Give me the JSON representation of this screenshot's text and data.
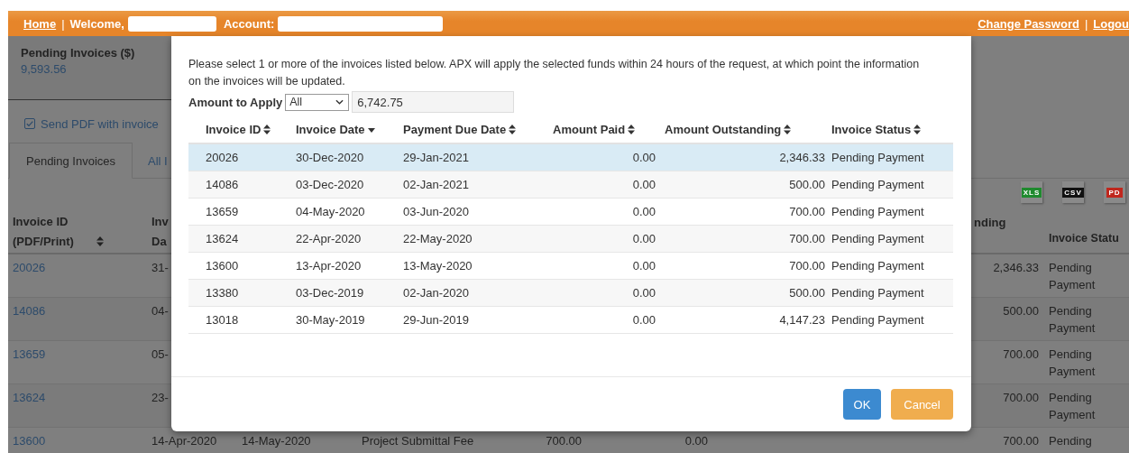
{
  "top_bar": {
    "home": "Home",
    "separator_left": "|",
    "welcome": "Welcome,",
    "account": "Account:",
    "change_password": "Change Password",
    "separator_right": "|",
    "logout": "Logou"
  },
  "summary": {
    "title": "Pending Invoices ($)",
    "value": "9,593.56"
  },
  "send_pdf": {
    "label": "Send PDF with invoice",
    "checked": true
  },
  "tabs": [
    {
      "label": "Pending Invoices",
      "selected": true
    },
    {
      "label": "All I",
      "selected": false
    }
  ],
  "exports": [
    {
      "label": "XLS",
      "color": "#1f8a2e"
    },
    {
      "label": "CSV",
      "color": "#111111"
    },
    {
      "label": "PD",
      "color": "#c0271d"
    }
  ],
  "invoice_table": {
    "columns": [
      {
        "label": "Invoice ID (PDF/Print)",
        "sortable": true
      },
      {
        "label": "Inv Da"
      },
      {
        "label": "nding"
      },
      {
        "label": "Invoice Statu"
      }
    ],
    "rows": [
      {
        "id": "20026",
        "invoice_date": "31-",
        "outstanding": "2,346.33",
        "status": "Pending Payment"
      },
      {
        "id": "14086",
        "invoice_date": "04-",
        "outstanding": "500.00",
        "status": "Pending Payment"
      },
      {
        "id": "13659",
        "invoice_date": "05-",
        "outstanding": "700.00",
        "status": "Pending Payment"
      },
      {
        "id": "13624",
        "invoice_date": "23-",
        "outstanding": "700.00",
        "status": "Pending Payment"
      },
      {
        "id": "13600",
        "invoice_date": "14-Apr-2020",
        "due_date": "14-May-2020",
        "description": "Project Submittal Fee",
        "amount": "700.00",
        "paid": "0.00",
        "outstanding": "700.00",
        "status": "Pending"
      }
    ]
  },
  "dialog": {
    "message": "Please select 1 or more of the invoices listed below. APX will apply the selected funds within 24 hours of the request, at which point the information on the invoices will be updated.",
    "amount_label": "Amount to Apply",
    "amount_mode": "All",
    "amount_value": "6,742.75",
    "columns": [
      {
        "label": "Invoice ID",
        "sorted": false
      },
      {
        "label": "Invoice Date",
        "sorted": true
      },
      {
        "label": "Payment Due Date",
        "sorted": false
      },
      {
        "label": "Amount Paid",
        "sorted": false
      },
      {
        "label": "Amount Outstanding",
        "sorted": false
      },
      {
        "label": "Invoice Status",
        "sorted": false
      }
    ],
    "rows": [
      {
        "selected": true,
        "cells": [
          "20026",
          "30-Dec-2020",
          "29-Jan-2021",
          "0.00",
          "2,346.33",
          "Pending Payment"
        ]
      },
      {
        "selected": false,
        "cells": [
          "14086",
          "03-Dec-2020",
          "02-Jan-2021",
          "0.00",
          "500.00",
          "Pending Payment"
        ]
      },
      {
        "selected": false,
        "cells": [
          "13659",
          "04-May-2020",
          "03-Jun-2020",
          "0.00",
          "700.00",
          "Pending Payment"
        ]
      },
      {
        "selected": false,
        "cells": [
          "13624",
          "22-Apr-2020",
          "22-May-2020",
          "0.00",
          "700.00",
          "Pending Payment"
        ]
      },
      {
        "selected": false,
        "cells": [
          "13600",
          "13-Apr-2020",
          "13-May-2020",
          "0.00",
          "700.00",
          "Pending Payment"
        ]
      },
      {
        "selected": false,
        "cells": [
          "13380",
          "03-Dec-2019",
          "02-Jan-2020",
          "0.00",
          "500.00",
          "Pending Payment"
        ]
      },
      {
        "selected": false,
        "cells": [
          "13018",
          "30-May-2019",
          "29-Jun-2019",
          "0.00",
          "4,147.23",
          "Pending Payment"
        ]
      }
    ],
    "ok": "OK",
    "cancel": "Cancel"
  }
}
